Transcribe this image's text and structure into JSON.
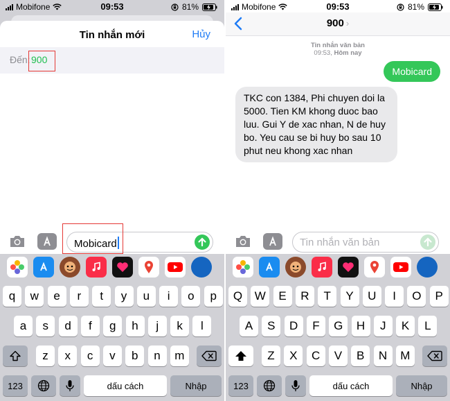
{
  "status_left": {
    "carrier": "Mobifone",
    "time": "09:53",
    "battery": "81%"
  },
  "status_right": {
    "carrier": "Mobifone",
    "time": "09:53",
    "battery": "81%"
  },
  "compose": {
    "title": "Tin nhắn mới",
    "cancel_label": "Hủy",
    "to_label": "Đến:",
    "to_value": "900",
    "message_value": "Mobicard"
  },
  "conversation": {
    "contact": "900",
    "meta_type": "Tin nhắn văn bản",
    "meta_time": "09:53,",
    "meta_day": "Hôm nay",
    "outgoing": "Mobicard",
    "incoming": "TKC con 1384, Phi chuyen doi la 5000. Tien KM khong duoc bao luu. Gui Y de xac nhan, N de huy bo. Yeu cau se bi huy bo sau 10 phut neu khong xac nhan",
    "placeholder": "Tin nhắn văn bản"
  },
  "apps": [
    "photos-icon",
    "app-store-icon",
    "memoji-icon",
    "music-icon",
    "digital-touch-icon",
    "maps-icon",
    "youtube-icon"
  ],
  "keyboard": {
    "left_rows": [
      [
        "q",
        "w",
        "e",
        "r",
        "t",
        "y",
        "u",
        "i",
        "o",
        "p"
      ],
      [
        "a",
        "s",
        "d",
        "f",
        "g",
        "h",
        "j",
        "k",
        "l"
      ],
      [
        "z",
        "x",
        "c",
        "v",
        "b",
        "n",
        "m"
      ]
    ],
    "right_rows": [
      [
        "Q",
        "W",
        "E",
        "R",
        "T",
        "Y",
        "U",
        "I",
        "O",
        "P"
      ],
      [
        "A",
        "S",
        "D",
        "F",
        "G",
        "H",
        "J",
        "K",
        "L"
      ],
      [
        "Z",
        "X",
        "C",
        "V",
        "B",
        "N",
        "M"
      ]
    ],
    "numbers_label": "123",
    "space_label": "dấu cách",
    "return_label": "Nhập"
  },
  "colors": {
    "accent": "#1f7cf5",
    "green": "#34c759",
    "highlight": "#e53935"
  }
}
